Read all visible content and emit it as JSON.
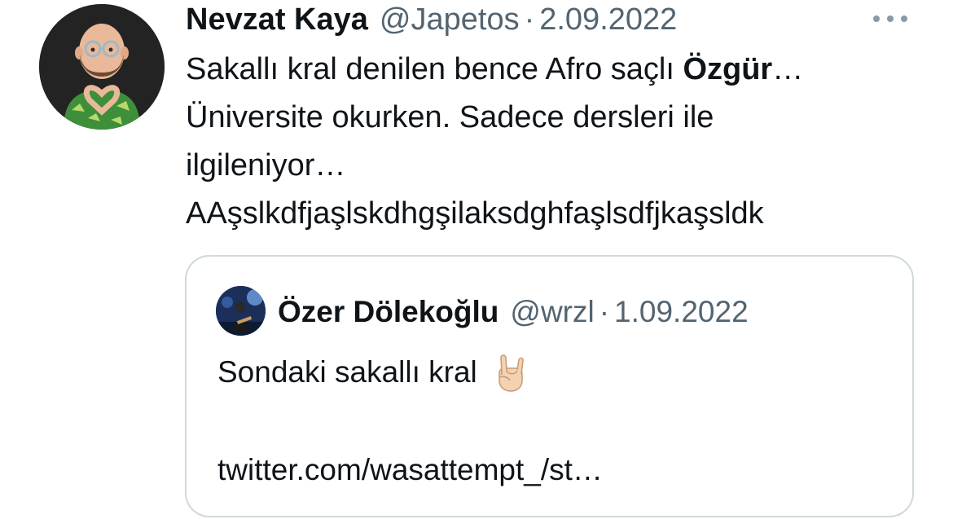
{
  "tweet": {
    "author": {
      "name": "Nevzat Kaya",
      "handle": "@Japetos",
      "avatar_icon": "memoji-heart-hands-avatar"
    },
    "separator": "·",
    "date": "2.09.2022",
    "more_icon": "more-dots-icon",
    "body": {
      "line1_prefix": "Sakallı kral denilen bence Afro saçlı ",
      "line1_bold": "Özgür",
      "line1_suffix": "…",
      "line2": "Üniversite okurken. Sadece dersleri ile",
      "line3": "ilgileniyor…",
      "line4": "AAşslkdfjaşlskdhgşilaksdghfaşlsdfjkaşsldk"
    },
    "quote": {
      "author": {
        "name": "Özer Dölekoğlu",
        "handle": "@wrzl",
        "avatar_icon": "concert-photo-avatar"
      },
      "separator": "·",
      "date": "1.09.2022",
      "text": "Sondaki sakallı kral",
      "emoji_icon": "sign-of-the-horns-emoji",
      "link": "twitter.com/wasattempt_/st…"
    }
  }
}
